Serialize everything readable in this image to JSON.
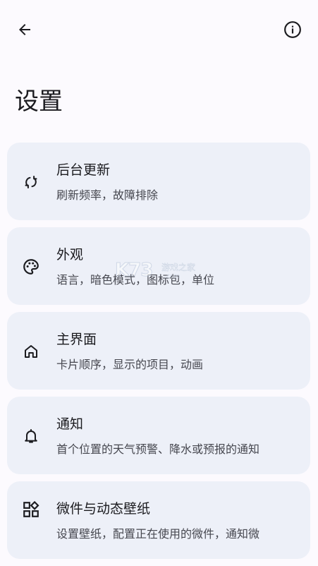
{
  "header": {
    "back_icon": "arrow-left-icon",
    "info_icon": "info-circle-icon"
  },
  "page": {
    "title": "设置"
  },
  "settings": [
    {
      "id": "background-updates",
      "icon": "sync-icon",
      "title": "后台更新",
      "subtitle": "刷新频率，故障排除"
    },
    {
      "id": "appearance",
      "icon": "palette-icon",
      "title": "外观",
      "subtitle": "语言，暗色模式，图标包，单位"
    },
    {
      "id": "main-screen",
      "icon": "home-icon",
      "title": "主界面",
      "subtitle": "卡片顺序，显示的项目，动画"
    },
    {
      "id": "notifications",
      "icon": "bell-icon",
      "title": "通知",
      "subtitle": "首个位置的天气预警、降水或预报的通知"
    },
    {
      "id": "widgets-wallpaper",
      "icon": "widgets-icon",
      "title": "微件与动态壁纸",
      "subtitle": "设置壁纸，配置正在使用的微件，通知微"
    }
  ],
  "watermark": {
    "logo": "K73",
    "text": "游戏之家",
    "url": ".com"
  }
}
